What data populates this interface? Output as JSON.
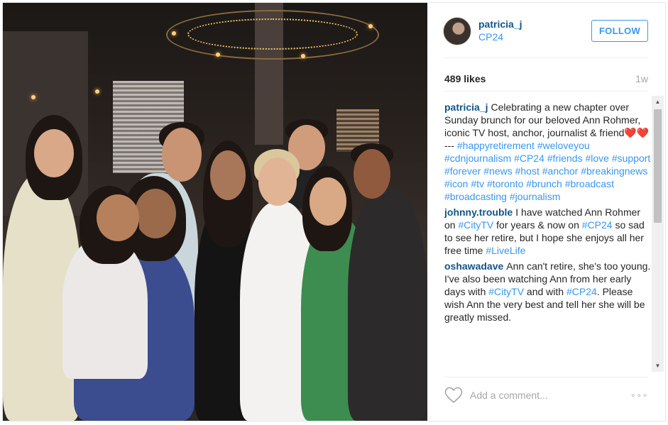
{
  "post": {
    "username": "patricia_j",
    "location": "CP24",
    "follow_label": "FOLLOW",
    "likes": "489 likes",
    "time_ago": "1w"
  },
  "comments": [
    {
      "user": "patricia_j",
      "text_segments": [
        {
          "t": "Celebrating a new chapter over Sunday brunch for our beloved Ann Rohmer, iconic TV host, anchor, journalist & friend❤️❤️ --- ",
          "tag": false
        },
        {
          "t": "#happyretirement",
          "tag": true
        },
        {
          "t": " ",
          "tag": false
        },
        {
          "t": "#weloveyou",
          "tag": true
        },
        {
          "t": " ",
          "tag": false
        },
        {
          "t": "#cdnjournalism",
          "tag": true
        },
        {
          "t": " ",
          "tag": false
        },
        {
          "t": "#CP24",
          "tag": true
        },
        {
          "t": " ",
          "tag": false
        },
        {
          "t": "#friends",
          "tag": true
        },
        {
          "t": " ",
          "tag": false
        },
        {
          "t": "#love",
          "tag": true
        },
        {
          "t": " ",
          "tag": false
        },
        {
          "t": "#support",
          "tag": true
        },
        {
          "t": " ",
          "tag": false
        },
        {
          "t": "#forever",
          "tag": true
        },
        {
          "t": " ",
          "tag": false
        },
        {
          "t": "#news",
          "tag": true
        },
        {
          "t": " ",
          "tag": false
        },
        {
          "t": "#host",
          "tag": true
        },
        {
          "t": " ",
          "tag": false
        },
        {
          "t": "#anchor",
          "tag": true
        },
        {
          "t": " ",
          "tag": false
        },
        {
          "t": "#breakingnews",
          "tag": true
        },
        {
          "t": " ",
          "tag": false
        },
        {
          "t": "#icon",
          "tag": true
        },
        {
          "t": " ",
          "tag": false
        },
        {
          "t": "#tv",
          "tag": true
        },
        {
          "t": " ",
          "tag": false
        },
        {
          "t": "#toronto",
          "tag": true
        },
        {
          "t": " ",
          "tag": false
        },
        {
          "t": "#brunch",
          "tag": true
        },
        {
          "t": " ",
          "tag": false
        },
        {
          "t": "#broadcast",
          "tag": true
        },
        {
          "t": " ",
          "tag": false
        },
        {
          "t": "#broadcasting",
          "tag": true
        },
        {
          "t": " ",
          "tag": false
        },
        {
          "t": "#journalism",
          "tag": true
        }
      ]
    },
    {
      "user": "johnny.trouble",
      "text_segments": [
        {
          "t": "I have watched Ann Rohmer on ",
          "tag": false
        },
        {
          "t": "#CityTV",
          "tag": true
        },
        {
          "t": " for years & now on ",
          "tag": false
        },
        {
          "t": "#CP24",
          "tag": true
        },
        {
          "t": " so sad to see her retire, but I hope she enjoys all her free time ",
          "tag": false
        },
        {
          "t": "#LiveLife",
          "tag": true
        }
      ]
    },
    {
      "user": "oshawadave",
      "text_segments": [
        {
          "t": "Ann can't retire, she's too young. I've also been watching Ann from her early days with ",
          "tag": false
        },
        {
          "t": "#CityTV",
          "tag": true
        },
        {
          "t": " and with ",
          "tag": false
        },
        {
          "t": "#CP24",
          "tag": true
        },
        {
          "t": ". Please wish Ann the very best and tell her she will be greatly missed.",
          "tag": false
        }
      ]
    }
  ],
  "comment_input": {
    "placeholder": "Add a comment..."
  },
  "more_options": "∘∘∘",
  "scroll": {
    "up": "▲",
    "down": "▼"
  },
  "icons": {
    "like": "heart-icon",
    "more": "more-options-icon",
    "avatar": "avatar"
  },
  "colors": {
    "username": "#125688",
    "hashtag": "#3897f0",
    "follow": "#3897f0",
    "muted": "#a5a7aa"
  }
}
